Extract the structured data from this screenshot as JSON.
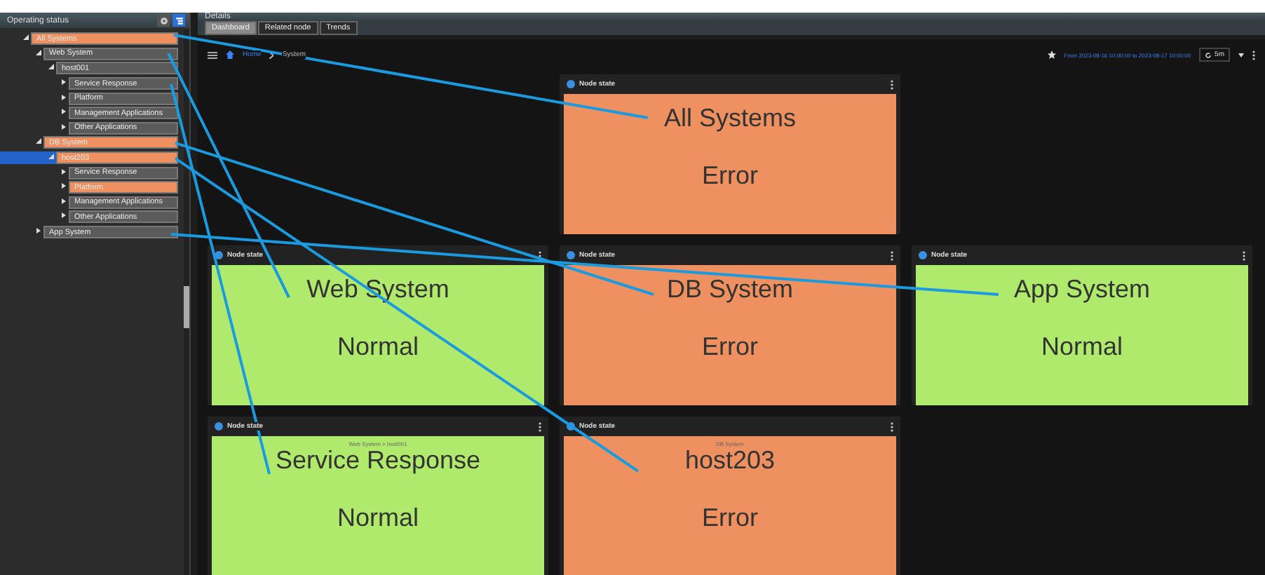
{
  "operating_status": {
    "title": "Operating status",
    "tree": [
      {
        "label": "All Systems",
        "highlighted": true,
        "selected": false,
        "expanded": true,
        "children": [
          {
            "label": "Web System",
            "highlighted": false,
            "selected": false,
            "expanded": true,
            "children": [
              {
                "label": "host001",
                "highlighted": false,
                "selected": false,
                "expanded": true,
                "children": [
                  {
                    "label": "Service Response",
                    "highlighted": false,
                    "selected": false,
                    "expanded": false
                  },
                  {
                    "label": "Platform",
                    "highlighted": false,
                    "selected": false,
                    "expanded": false
                  },
                  {
                    "label": "Management Applications",
                    "highlighted": false,
                    "selected": false,
                    "expanded": false
                  },
                  {
                    "label": "Other Applications",
                    "highlighted": false,
                    "selected": false,
                    "expanded": false
                  }
                ]
              }
            ]
          },
          {
            "label": "DB System",
            "highlighted": true,
            "selected": false,
            "expanded": true,
            "children": [
              {
                "label": "host203",
                "highlighted": true,
                "selected": true,
                "expanded": true,
                "children": [
                  {
                    "label": "Service Response",
                    "highlighted": false,
                    "selected": false,
                    "expanded": false
                  },
                  {
                    "label": "Platform",
                    "highlighted": true,
                    "selected": false,
                    "expanded": false
                  },
                  {
                    "label": "Management Applications",
                    "highlighted": false,
                    "selected": false,
                    "expanded": false
                  },
                  {
                    "label": "Other Applications",
                    "highlighted": false,
                    "selected": false,
                    "expanded": false
                  }
                ]
              }
            ]
          },
          {
            "label": "App System",
            "highlighted": false,
            "selected": false,
            "expanded": false
          }
        ]
      }
    ]
  },
  "details": {
    "title": "Details",
    "tabs": [
      {
        "label": "Dashboard",
        "selected": true
      },
      {
        "label": "Related node",
        "selected": false
      },
      {
        "label": "Trends",
        "selected": false
      }
    ],
    "breadcrumb": [
      "Home",
      "System"
    ],
    "time_range": "From 2023-08-16 10:00:00 to 2023-08-17 10:00:00",
    "refresh": "5m",
    "tile_rows": [
      [
        {
          "kind": "empty"
        },
        {
          "kind": "error",
          "header": "Node state",
          "name": "All Systems",
          "status": "Error"
        },
        {
          "kind": "empty"
        }
      ],
      [
        {
          "kind": "normal",
          "header": "Node state",
          "name": "Web System",
          "status": "Normal"
        },
        {
          "kind": "error",
          "header": "Node state",
          "name": "DB System",
          "status": "Error"
        },
        {
          "kind": "normal",
          "header": "Node state",
          "name": "App System",
          "status": "Normal"
        }
      ],
      [
        {
          "kind": "normal",
          "header": "Node state",
          "subtitle": "Web System > host001",
          "name": "Service Response",
          "status": "Normal"
        },
        {
          "kind": "error",
          "header": "Node state",
          "subtitle": "DB System",
          "name": "host203",
          "status": "Error"
        },
        {
          "kind": "empty"
        }
      ]
    ]
  }
}
